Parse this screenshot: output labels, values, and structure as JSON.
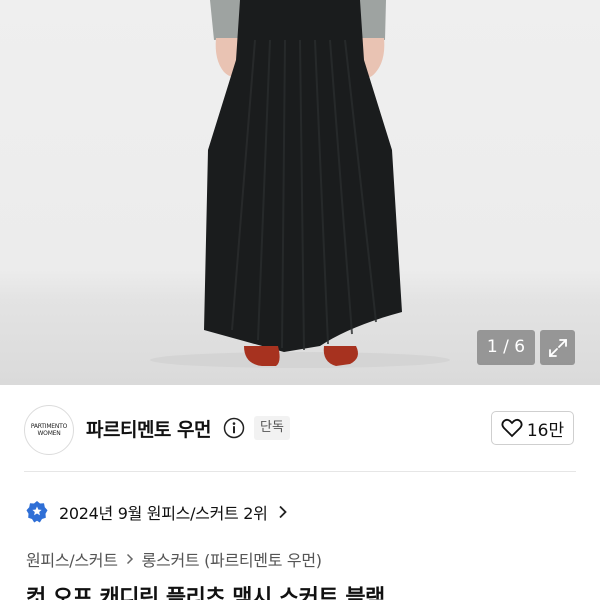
{
  "gallery": {
    "counter": "1 / 6"
  },
  "brand": {
    "logo_line1": "PARTIMENTO",
    "logo_line2": "WOMEN",
    "name": "파르티멘토 우먼",
    "badge": "단독"
  },
  "like": {
    "count": "16만"
  },
  "ranking": {
    "text": "2024년 9월 원피스/스커트 2위"
  },
  "breadcrumb": {
    "category": "원피스/스커트",
    "sub_category": "롱스커트 (파르티멘토 우먼)"
  },
  "product": {
    "title": "컷 오프 캐디린 플리츠 맥시 스커트 블랙"
  },
  "colors": {
    "skirt": "#1a1c1d",
    "shoes": "#a7321f",
    "sleeves": "#9ea3a1",
    "rank_badge": "#2f6fd6"
  }
}
